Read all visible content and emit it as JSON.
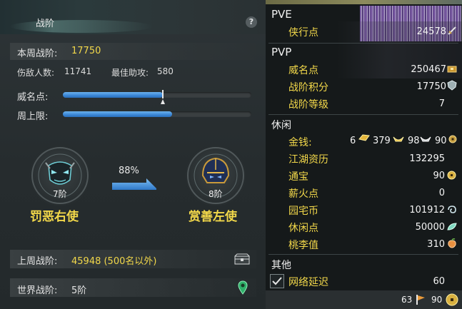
{
  "left_panel": {
    "title": "战阶",
    "help": "?",
    "weekly_rank_label": "本周战阶:",
    "weekly_rank_value": "17750",
    "kills_label": "伤敌人数:",
    "kills_value": "11741",
    "assists_label": "最佳助攻:",
    "assists_value": "580",
    "prestige_label": "威名点:",
    "prestige_progress": 0.53,
    "weekly_cap_label": "周上限:",
    "weekly_cap_progress": 0.58,
    "current_rank_level": "7阶",
    "current_rank_name": "罚恶右使",
    "next_rank_level": "8阶",
    "next_rank_name": "赏善左使",
    "progress_percent": "88%",
    "last_week_label": "上周战阶:",
    "last_week_value": "45948 (500名以外)",
    "world_rank_label": "世界战阶:",
    "world_rank_value": "5阶"
  },
  "right_panel": {
    "pve": {
      "title": "PVE",
      "items": [
        {
          "name": "侠行点",
          "value": "24578",
          "icon": "sword-icon"
        }
      ]
    },
    "pvp": {
      "title": "PVP",
      "items": [
        {
          "name": "威名点",
          "value": "250467",
          "icon": "chest-icon"
        },
        {
          "name": "战阶积分",
          "value": "17750",
          "icon": "crest-icon"
        },
        {
          "name": "战阶等级",
          "value": "7"
        }
      ]
    },
    "leisure": {
      "title": "休闲",
      "money_label": "金钱:",
      "money_zhuan": "6",
      "money_jin": "379",
      "money_yin": "98",
      "money_tong": "90",
      "items": [
        {
          "name": "江湖资历",
          "value": "132295"
        },
        {
          "name": "通宝",
          "value": "90",
          "icon": "coin-icon"
        },
        {
          "name": "薪火点",
          "value": "0"
        },
        {
          "name": "园宅币",
          "value": "101912",
          "icon": "swirl-icon"
        },
        {
          "name": "休闲点",
          "value": "50000",
          "icon": "leaf-icon"
        },
        {
          "name": "桃李值",
          "value": "310",
          "icon": "peach-icon"
        }
      ]
    },
    "other": {
      "title": "其他",
      "latency_label": "网络延迟",
      "latency_value": "60",
      "latency_checked": true
    },
    "bottom": {
      "value_a": "63",
      "value_b": "90"
    }
  },
  "colors": {
    "accent_yellow": "#f2d84a",
    "bar_blue": "#3a86d6",
    "panel_bg": "#262c2e",
    "right_bg": "#15191a"
  }
}
